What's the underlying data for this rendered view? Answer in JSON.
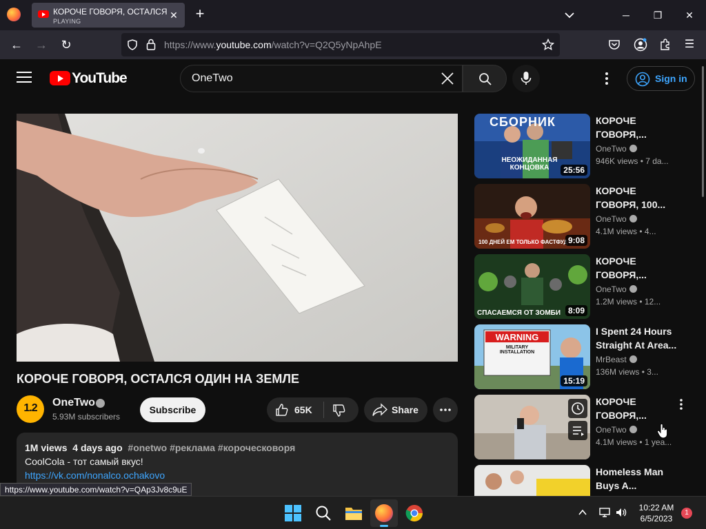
{
  "browser": {
    "tab": {
      "title": "КОРОЧЕ ГОВОРЯ, ОСТАЛСЯ ОДИН НА ЗЕМЛЕ",
      "status": "PLAYING"
    },
    "url_prefix": "https://www.",
    "url_host": "youtube.com",
    "url_path": "/watch?v=Q2Q5yNpAhpE"
  },
  "header": {
    "logo": "YouTube",
    "search_value": "OneTwo",
    "signin_label": "Sign in"
  },
  "video": {
    "title": "КОРОЧЕ ГОВОРЯ, ОСТАЛСЯ ОДИН НА ЗЕМЛЕ",
    "channel": "OneTwo",
    "channel_avatar_text": "1.2",
    "subscribers": "5.93M subscribers",
    "subscribe_label": "Subscribe",
    "likes": "65K",
    "share_label": "Share"
  },
  "description": {
    "views": "1M views",
    "age": "4 days ago",
    "tags": "#onetwo #реклама #короческоворя",
    "line2": "CoolCola - тот самый вкус!",
    "link": "https://vk.com/nonalco.ochakovo"
  },
  "status_url": "https://www.youtube.com/watch?v=QAp3Jv8c9uE",
  "recommendations": [
    {
      "title": "КОРОЧЕ ГОВОРЯ,...",
      "channel": "OneTwo",
      "meta": "946K views • 7 da...",
      "duration": "25:56",
      "thumb_text": "СБОРНИК",
      "thumb_text2": "НЕОЖИДАННАЯ КОНЦОВКА"
    },
    {
      "title": "КОРОЧЕ ГОВОРЯ, 100...",
      "channel": "OneTwo",
      "meta": "4.1M views • 4...",
      "duration": "9:08",
      "thumb_text": "100 ДНЕЙ ЕМ ТОЛЬКО ФАСТФУД"
    },
    {
      "title": "КОРОЧЕ ГОВОРЯ,...",
      "channel": "OneTwo",
      "meta": "1.2M views • 12...",
      "duration": "8:09",
      "thumb_text": "СПАСАЕМСЯ ОТ ЗОМБИ"
    },
    {
      "title": "I Spent 24 Hours Straight At Area...",
      "channel": "MrBeast",
      "meta": "136M views • 3...",
      "duration": "15:19",
      "thumb_text": "WARNING",
      "thumb_text2": "MILITARY INSTALLATION"
    },
    {
      "title": "КОРОЧЕ ГОВОРЯ,...",
      "channel": "OneTwo",
      "meta": "4.1M views • 1 yea..."
    },
    {
      "title": "Homeless Man Buys A..."
    }
  ],
  "taskbar": {
    "time": "10:22 AM",
    "date": "6/5/2023",
    "notifications": "1"
  },
  "colors": {
    "accent": "#3ea6ff",
    "brand": "#ff0000",
    "background": "#0f0f0f"
  }
}
